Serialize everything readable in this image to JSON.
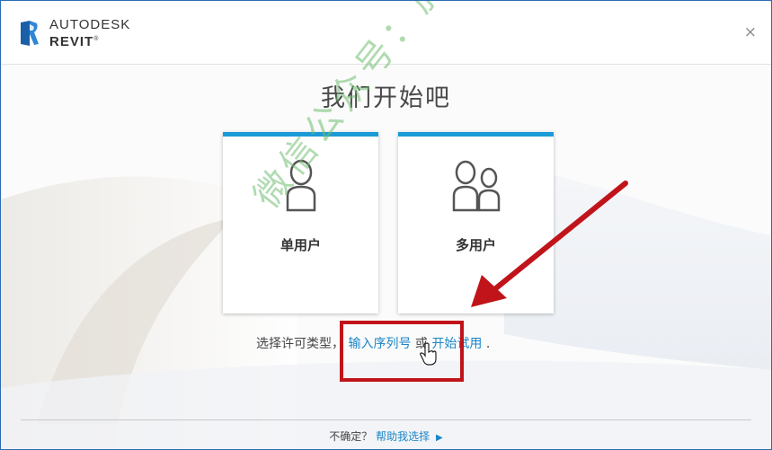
{
  "header": {
    "brand_line1": "AUTODESK",
    "brand_line2": "REVIT",
    "brand_mark": "®",
    "logo_icon": "revit-r-logo",
    "close_label": "×"
  },
  "main": {
    "heading": "我们开始吧",
    "cards": [
      {
        "label": "单用户",
        "icon": "single-user-icon"
      },
      {
        "label": "多用户",
        "icon": "multi-user-icon"
      }
    ],
    "license": {
      "prefix": "选择许可类型，",
      "serial_link": "输入序列号",
      "or_text": " 或 ",
      "trial_link": "开始试用",
      "suffix": "."
    }
  },
  "footer": {
    "question": "不确定？",
    "help_link": "帮助我选择"
  },
  "overlay": {
    "watermark": "微信公众号：施工者"
  },
  "colors": {
    "accent": "#1a9ad6",
    "link": "#1a86c8",
    "annotation": "#c0141a",
    "watermark": "#70be70"
  }
}
